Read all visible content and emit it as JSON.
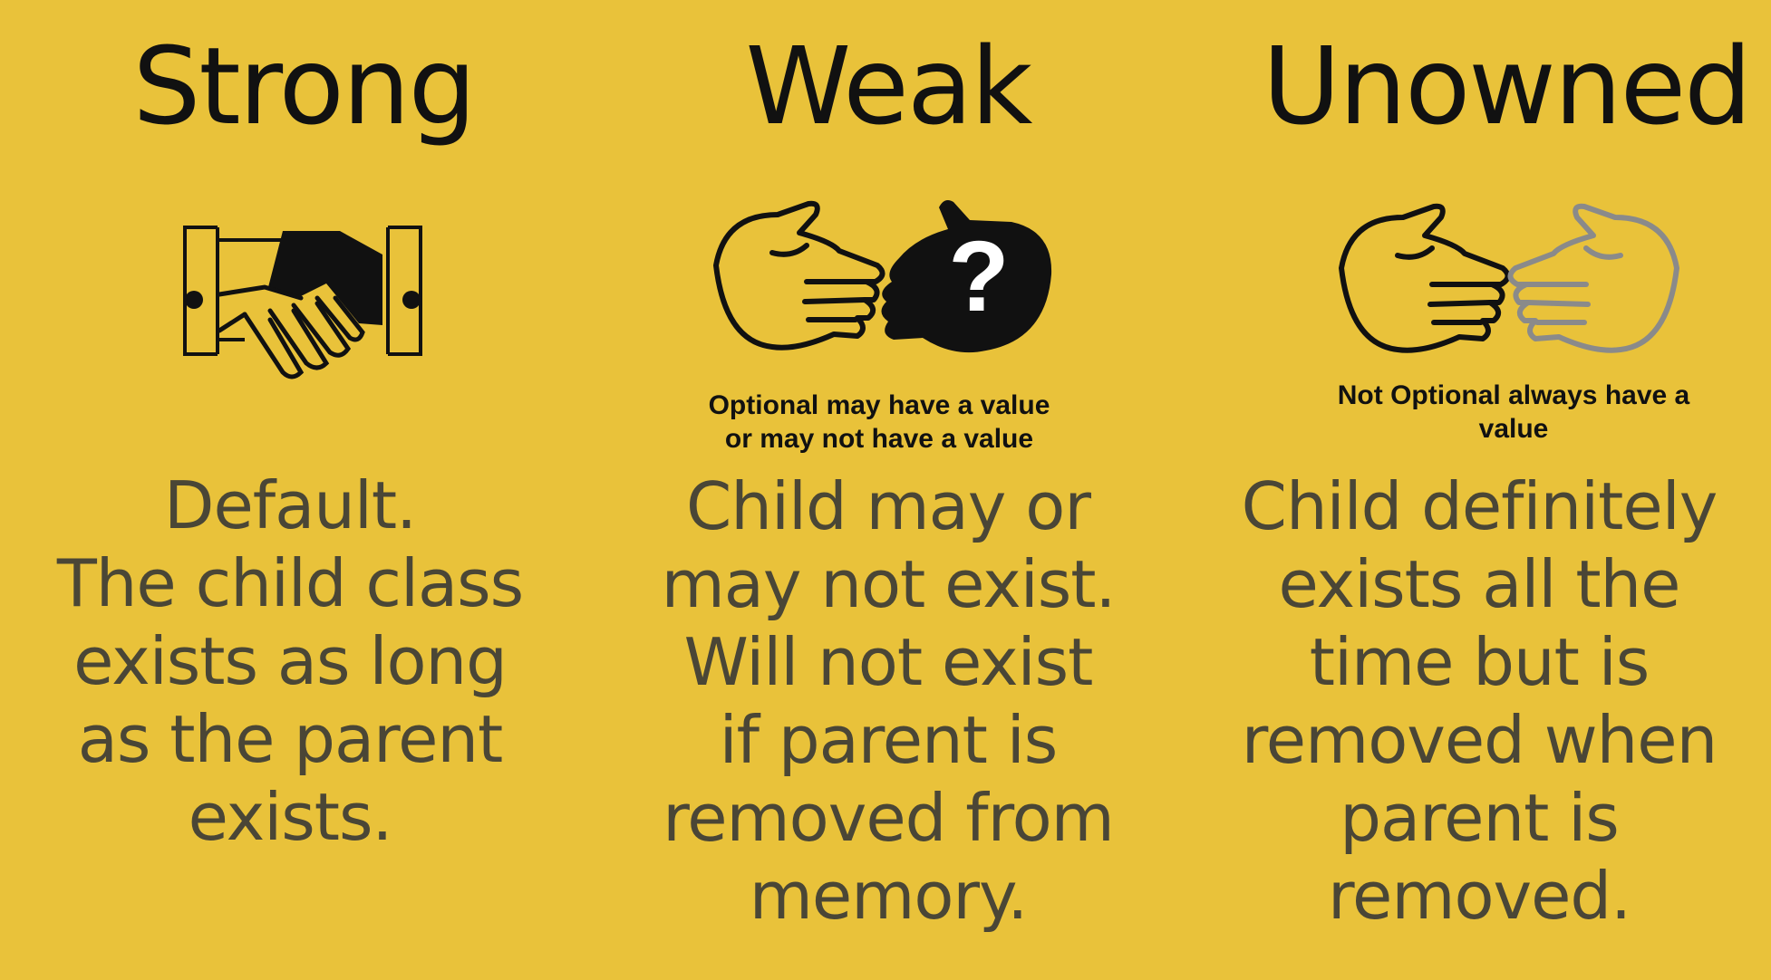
{
  "columns": [
    {
      "title": "Strong",
      "icon": "handshake-icon",
      "note": [],
      "description_lines": [
        "Default.",
        "The child class",
        "exists as long",
        "as the parent",
        "exists."
      ]
    },
    {
      "title": "Weak",
      "icon": "hand-and-question-hand-icon",
      "note": [
        "Optional may have a value",
        "or may not have a value"
      ],
      "description_lines": [
        "Child may or",
        "may not exist.",
        "Will not exist",
        "if parent is",
        "removed from",
        "memory."
      ]
    },
    {
      "title": "Unowned",
      "icon": "hand-and-faded-hand-icon",
      "note": [
        "Not Optional always have a",
        "value"
      ],
      "description_lines": [
        "Child definitely",
        "exists all the",
        "time but is",
        "removed when",
        "parent is",
        "removed."
      ]
    }
  ],
  "colors": {
    "background": "#E9C23A",
    "title": "#111111",
    "description": "#4a4636",
    "faded_hand": "#8a8a8a"
  }
}
